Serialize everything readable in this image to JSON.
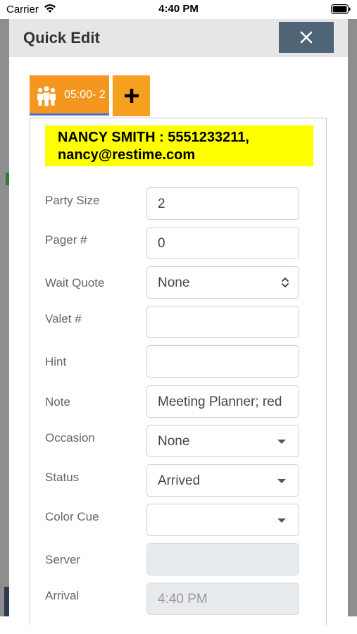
{
  "status_bar": {
    "carrier": "Carrier",
    "time": "4:40 PM"
  },
  "modal": {
    "title": "Quick Edit",
    "close_icon": "close-icon"
  },
  "tabs": {
    "party_tab": {
      "icon": "group-people-icon",
      "label": "05:00- 2"
    },
    "add_tab": {
      "icon": "plus-icon"
    }
  },
  "guest_banner": {
    "line1": "NANCY SMITH : 5551233211,",
    "line2": "nancy@restime.com"
  },
  "form": {
    "party_size": {
      "label": "Party Size",
      "value": "2"
    },
    "pager": {
      "label": "Pager #",
      "value": "0"
    },
    "wait_quote": {
      "label": "Wait Quote",
      "value": "None"
    },
    "valet": {
      "label": "Valet #",
      "value": ""
    },
    "hint": {
      "label": "Hint",
      "value": ""
    },
    "note": {
      "label": "Note",
      "value": "Meeting Planner; red"
    },
    "occasion": {
      "label": "Occasion",
      "value": "None"
    },
    "status": {
      "label": "Status",
      "value": "Arrived"
    },
    "color_cue": {
      "label": "Color Cue",
      "value": ""
    },
    "server": {
      "label": "Server",
      "value": ""
    },
    "arrival": {
      "label": "Arrival",
      "value": "4:40 PM"
    }
  },
  "colors": {
    "tab_orange": "#f5961e",
    "banner_yellow": "#ffff00",
    "close_button": "#4f6577"
  }
}
